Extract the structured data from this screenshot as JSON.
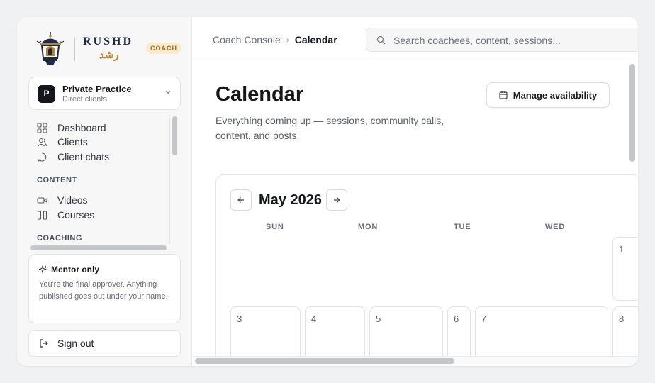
{
  "brand": {
    "name": "RUSHD",
    "arabic": "رشد",
    "badge": "COACH"
  },
  "practice": {
    "avatar_letter": "P",
    "title": "Private Practice",
    "subtitle": "Direct clients"
  },
  "sidebar": {
    "items": [
      {
        "label": "Dashboard",
        "icon": "grid-icon"
      },
      {
        "label": "Clients",
        "icon": "users-icon"
      },
      {
        "label": "Client chats",
        "icon": "chat-icon"
      }
    ],
    "sections": [
      {
        "label": "CONTENT",
        "items": [
          {
            "label": "Videos",
            "icon": "video-icon"
          },
          {
            "label": "Courses",
            "icon": "columns-icon"
          }
        ]
      },
      {
        "label": "COACHING",
        "items": []
      }
    ]
  },
  "mentor": {
    "title": "Mentor only",
    "text": "You're the final approver. Anything published goes out under your name."
  },
  "signout": {
    "label": "Sign out"
  },
  "breadcrumb": {
    "parent": "Coach Console",
    "current": "Calendar"
  },
  "search": {
    "placeholder": "Search coachees, content, sessions..."
  },
  "page": {
    "title": "Calendar",
    "description": "Everything coming up — sessions, community calls, content, and posts.",
    "manage_label": "Manage availability"
  },
  "calendar": {
    "month_label": "May 2026",
    "weekdays": [
      "SUN",
      "MON",
      "TUE",
      "WED"
    ],
    "week1": [
      "1"
    ],
    "week2": [
      "3",
      "4",
      "5",
      "6",
      "7",
      "8"
    ]
  },
  "colors": {
    "accent_gold": "#b8862d",
    "badge_bg": "#fbeacc",
    "navy": "#1f2a44"
  }
}
